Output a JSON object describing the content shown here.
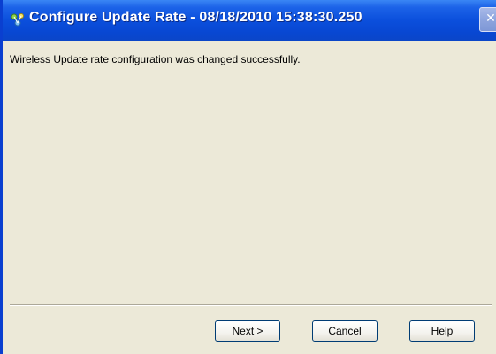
{
  "window": {
    "title": "Configure Update Rate - 08/18/2010 15:38:30.250",
    "close_glyph": "✕",
    "icon": "network-wizard-icon"
  },
  "main": {
    "message": "Wireless Update rate configuration was changed successfully."
  },
  "buttons": {
    "next_label": "Next >",
    "cancel_label": "Cancel",
    "help_label": "Help"
  },
  "colors": {
    "titlebar": "#0b4fdc",
    "dialog_background": "#ece9d8",
    "button_border": "#003c74"
  }
}
